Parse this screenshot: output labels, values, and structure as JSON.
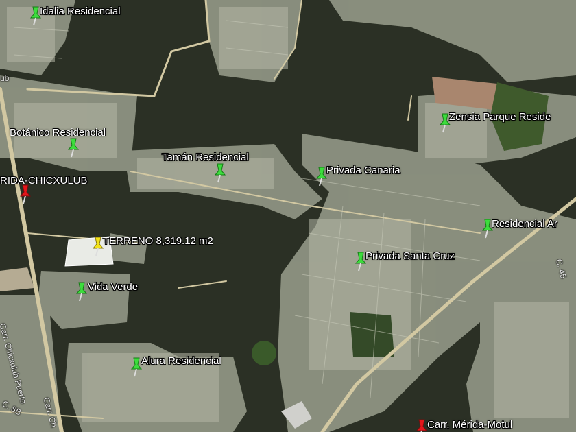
{
  "map": {
    "view": "satellite",
    "colors": {
      "vegetation_dark": "#2b3025",
      "urban_light": "#9ca08f",
      "road": "#d2c8a2",
      "pin_green": "#3ddc3d",
      "pin_yellow": "#f2e21a",
      "pin_red": "#e3161b"
    },
    "placemarks": [
      {
        "id": "idalia",
        "label": "Idalia Residencial",
        "pin": "green"
      },
      {
        "id": "botanico",
        "label": "Botánico Residencial",
        "pin": "green"
      },
      {
        "id": "taman",
        "label": "Tamán Residencial",
        "pin": "green"
      },
      {
        "id": "canaria",
        "label": "Privada Canaria",
        "pin": "green"
      },
      {
        "id": "zensia",
        "label": "Zensia Parque Reside",
        "pin": "green"
      },
      {
        "id": "residencial-a",
        "label": "Residencial Ar",
        "pin": "green"
      },
      {
        "id": "santa-cruz",
        "label": "Privada Santa Cruz",
        "pin": "green"
      },
      {
        "id": "terreno",
        "label": "TERRENO 8,319.12 m2",
        "pin": "yellow"
      },
      {
        "id": "vida-verde",
        "label": "Vida Verde",
        "pin": "green"
      },
      {
        "id": "alura",
        "label": "Alura Residencial",
        "pin": "green"
      },
      {
        "id": "chicxulub",
        "label": "RIDA-CHICXULUB",
        "pin": "red"
      },
      {
        "id": "motul",
        "label": "Carr. Mérida-Motul",
        "pin": "red"
      }
    ],
    "road_labels": {
      "chicxulub_puerto": "Carr. Chicxulub Puerto",
      "ub": "ub",
      "c45": "C. 45",
      "c8b": "C. 8B",
      "car_ch": "Carr. Ch"
    }
  }
}
